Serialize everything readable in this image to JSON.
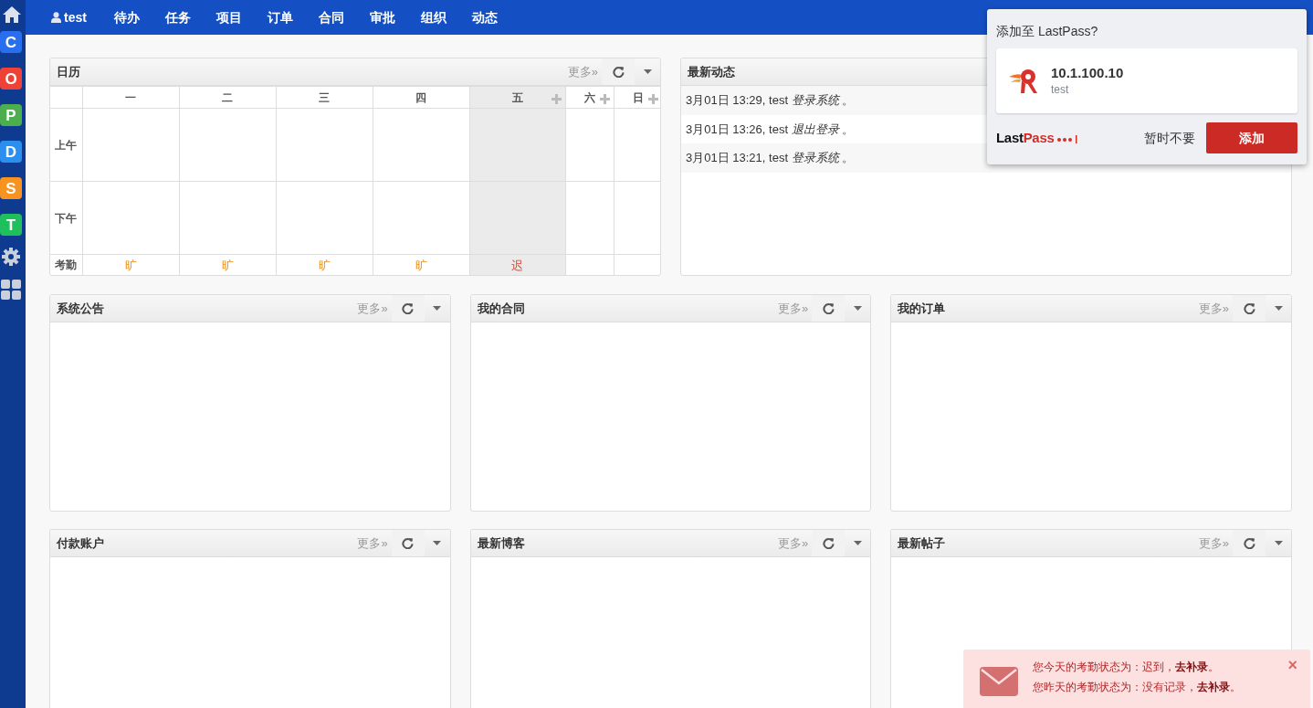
{
  "sidebar": {
    "apps": [
      {
        "letter": "C",
        "color": "#2a6ef0"
      },
      {
        "letter": "O",
        "color": "#ef4136"
      },
      {
        "letter": "P",
        "color": "#4cae4c"
      },
      {
        "letter": "D",
        "color": "#2b8ff0"
      },
      {
        "letter": "S",
        "color": "#f7931e"
      },
      {
        "letter": "T",
        "color": "#1fbf5b"
      }
    ]
  },
  "navbar": {
    "user": "test",
    "items": [
      "待办",
      "任务",
      "项目",
      "订单",
      "合同",
      "审批",
      "组织",
      "动态"
    ]
  },
  "calendar": {
    "title": "日历",
    "more": "更多»",
    "row_labels": [
      "上午",
      "下午"
    ],
    "attendance_label": "考勤",
    "days": [
      {
        "label": "一",
        "today": false,
        "can_add": false,
        "status": "旷",
        "kind": "absent"
      },
      {
        "label": "二",
        "today": false,
        "can_add": false,
        "status": "旷",
        "kind": "absent"
      },
      {
        "label": "三",
        "today": false,
        "can_add": false,
        "status": "旷",
        "kind": "absent"
      },
      {
        "label": "四",
        "today": false,
        "can_add": false,
        "status": "旷",
        "kind": "absent"
      },
      {
        "label": "五",
        "today": true,
        "can_add": true,
        "status": "迟",
        "kind": "late"
      },
      {
        "label": "六",
        "today": false,
        "can_add": true
      },
      {
        "label": "日",
        "today": false,
        "can_add": true
      }
    ]
  },
  "activity": {
    "title": "最新动态",
    "items": [
      "3月01日 13:29, test *登录系统* 。",
      "3月01日 13:26, test *退出登录* 。",
      "3月01日 13:21, test *登录系统* 。"
    ]
  },
  "widgets": [
    {
      "title": "系统公告",
      "more": "更多»"
    },
    {
      "title": "我的合同",
      "more": "更多»"
    },
    {
      "title": "我的订单",
      "more": "更多»"
    },
    {
      "title": "付款账户",
      "more": "更多»"
    },
    {
      "title": "最新博客",
      "more": "更多»"
    },
    {
      "title": "最新帖子",
      "more": "更多»"
    }
  ],
  "lastpass": {
    "title": "添加至 LastPass?",
    "site": "10.1.100.10",
    "user": "test",
    "logo_dark": "Last",
    "logo_red": "Pass",
    "buttons": [
      "暂时不要",
      "添加"
    ]
  },
  "alert": {
    "lines": [
      {
        "text": "您今天的考勤状态为：迟到，",
        "link": "去补录",
        "end": "。"
      },
      {
        "text": "您昨天的考勤状态为：没有记录，",
        "link": "去补录",
        "end": "。"
      }
    ],
    "close": "×"
  }
}
